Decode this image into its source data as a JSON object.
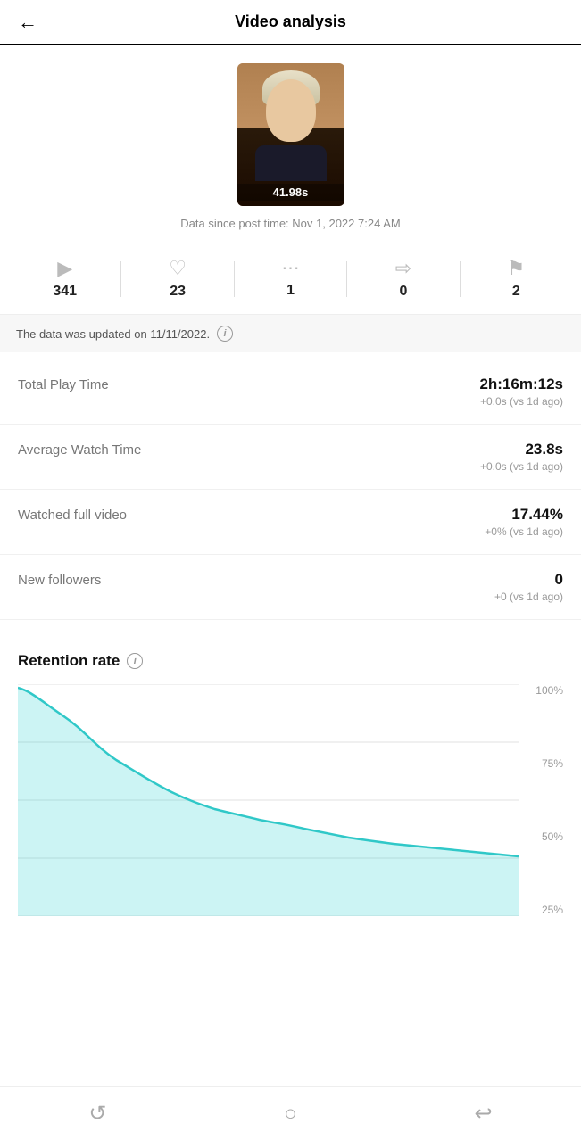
{
  "header": {
    "title": "Video analysis",
    "back_label": "←"
  },
  "video": {
    "duration": "41.98s",
    "date_label": "Data since post time: Nov 1, 2022 7:24 AM"
  },
  "stats": [
    {
      "icon": "▶",
      "value": "341",
      "name": "plays"
    },
    {
      "icon": "♡",
      "value": "23",
      "name": "likes"
    },
    {
      "icon": "💬",
      "value": "1",
      "name": "comments"
    },
    {
      "icon": "↪",
      "value": "0",
      "name": "shares"
    },
    {
      "icon": "🔖",
      "value": "2",
      "name": "saves"
    }
  ],
  "update_notice": {
    "text": "The data was updated on 11/11/2022.",
    "info_icon": "i"
  },
  "metrics": [
    {
      "label": "Total Play Time",
      "value": "2h:16m:12s",
      "change": "+0.0s (vs 1d ago)"
    },
    {
      "label": "Average Watch Time",
      "value": "23.8s",
      "change": "+0.0s (vs 1d ago)"
    },
    {
      "label": "Watched full video",
      "value": "17.44%",
      "change": "+0% (vs 1d ago)"
    },
    {
      "label": "New followers",
      "value": "0",
      "change": "+0 (vs 1d ago)"
    }
  ],
  "retention": {
    "title": "Retention rate",
    "info_icon": "i",
    "y_labels": [
      "100%",
      "75%",
      "50%",
      "25%"
    ],
    "chart_color": "#40d4d4",
    "chart_fill": "rgba(50,210,210,0.3)"
  },
  "bottom_nav": {
    "icons": [
      "↺",
      "○",
      "↩"
    ]
  }
}
